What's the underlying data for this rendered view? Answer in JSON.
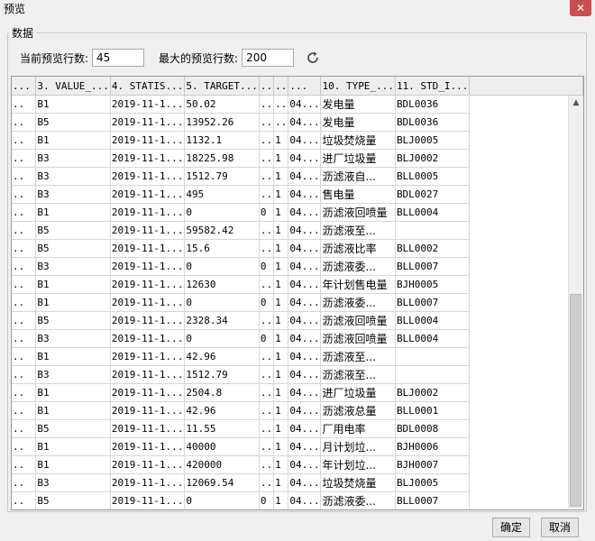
{
  "window": {
    "title": "预览",
    "close_label": "✕"
  },
  "group": {
    "label": "数据"
  },
  "controls": {
    "current_rows_label": "当前预览行数:",
    "current_rows_value": "45",
    "max_rows_label": "最大的预览行数:",
    "max_rows_value": "200"
  },
  "table": {
    "columns": [
      "...",
      "3. VALUE_...",
      "4. STATIS...",
      "5. TARGET...",
      "..",
      "..",
      "...",
      "10. TYPE_...",
      "11. STD_I..."
    ],
    "rows": [
      [
        "..",
        "B1",
        "2019-11-1...",
        "50.02",
        "..",
        "..",
        "04...",
        "发电量",
        "BDL0036"
      ],
      [
        "..",
        "B5",
        "2019-11-1...",
        "13952.26",
        "..",
        "..",
        "04...",
        "发电量",
        "BDL0036"
      ],
      [
        "..",
        "B1",
        "2019-11-1...",
        "1132.1",
        "..",
        "1",
        "04...",
        "垃圾焚烧量",
        "BLJ0005"
      ],
      [
        "..",
        "B3",
        "2019-11-1...",
        "18225.98",
        "..",
        "1",
        "04...",
        "进厂垃圾量",
        "BLJ0002"
      ],
      [
        "..",
        "B3",
        "2019-11-1...",
        "1512.79",
        "..",
        "1",
        "04...",
        "沥滤液自...",
        "BLL0005"
      ],
      [
        "..",
        "B3",
        "2019-11-1...",
        "495",
        "..",
        "1",
        "04...",
        "售电量",
        "BDL0027"
      ],
      [
        "..",
        "B1",
        "2019-11-1...",
        "0",
        "0",
        "1",
        "04...",
        "沥滤液回喷量",
        "BLL0004"
      ],
      [
        "..",
        "B5",
        "2019-11-1...",
        "59582.42",
        "..",
        "1",
        "04...",
        "沥滤液至...",
        ""
      ],
      [
        "..",
        "B5",
        "2019-11-1...",
        "15.6",
        "..",
        "1",
        "04...",
        "沥滤液比率",
        "BLL0002"
      ],
      [
        "..",
        "B3",
        "2019-11-1...",
        "0",
        "0",
        "1",
        "04...",
        "沥滤液委...",
        "BLL0007"
      ],
      [
        "..",
        "B1",
        "2019-11-1...",
        "12630",
        "..",
        "1",
        "04...",
        "年计划售电量",
        "BJH0005"
      ],
      [
        "..",
        "B1",
        "2019-11-1...",
        "0",
        "0",
        "1",
        "04...",
        "沥滤液委...",
        "BLL0007"
      ],
      [
        "..",
        "B5",
        "2019-11-1...",
        "2328.34",
        "..",
        "1",
        "04...",
        "沥滤液回喷量",
        "BLL0004"
      ],
      [
        "..",
        "B3",
        "2019-11-1...",
        "0",
        "0",
        "1",
        "04...",
        "沥滤液回喷量",
        "BLL0004"
      ],
      [
        "..",
        "B1",
        "2019-11-1...",
        "42.96",
        "..",
        "1",
        "04...",
        "沥滤液至...",
        ""
      ],
      [
        "..",
        "B3",
        "2019-11-1...",
        "1512.79",
        "..",
        "1",
        "04...",
        "沥滤液至...",
        ""
      ],
      [
        "..",
        "B1",
        "2019-11-1...",
        "2504.8",
        "..",
        "1",
        "04...",
        "进厂垃圾量",
        "BLJ0002"
      ],
      [
        "..",
        "B1",
        "2019-11-1...",
        "42.96",
        "..",
        "1",
        "04...",
        "沥滤液总量",
        "BLL0001"
      ],
      [
        "..",
        "B5",
        "2019-11-1...",
        "11.55",
        "..",
        "1",
        "04...",
        "厂用电率",
        "BDL0008"
      ],
      [
        "..",
        "B1",
        "2019-11-1...",
        "40000",
        "..",
        "1",
        "04...",
        "月计划垃...",
        "BJH0006"
      ],
      [
        "..",
        "B1",
        "2019-11-1...",
        "420000",
        "..",
        "1",
        "04...",
        "年计划垃...",
        "BJH0007"
      ],
      [
        "..",
        "B3",
        "2019-11-1...",
        "12069.54",
        "..",
        "1",
        "04...",
        "垃圾焚烧量",
        "BLJ0005"
      ],
      [
        "..",
        "B5",
        "2019-11-1...",
        "0",
        "0",
        "1",
        "04...",
        "沥滤液委...",
        "BLL0007"
      ]
    ]
  },
  "buttons": {
    "ok_label": "确定",
    "cancel_label": "取消"
  },
  "icons": {
    "refresh": "refresh-icon",
    "scroll_up": "scroll-up-icon",
    "scroll_down": "scroll-down-icon"
  }
}
